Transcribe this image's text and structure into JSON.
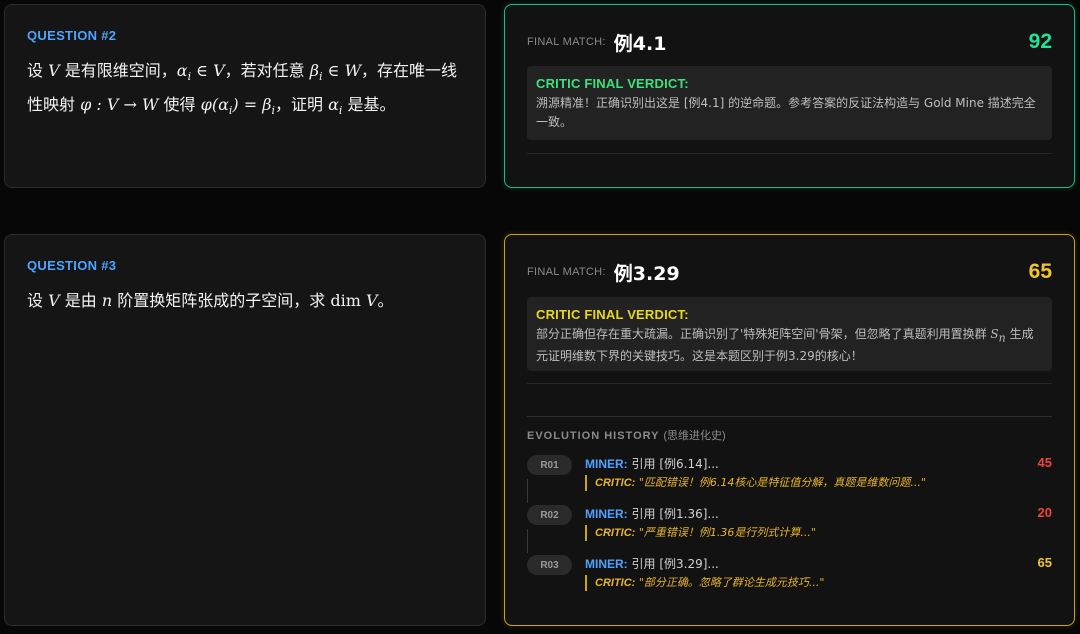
{
  "questions": [
    {
      "label": "QUESTION #2",
      "text_parts": [
        "设 ",
        "V",
        " 是有限维空间，",
        "α",
        "i",
        " ∈ ",
        "V",
        "，若对任意 ",
        "β",
        "i",
        " ∈ ",
        "W",
        "，存在唯一线性映射 ",
        "φ : V → W",
        " 使得 ",
        "φ(α",
        "i",
        ") = β",
        "i",
        "，证明 ",
        "α",
        "i",
        " 是基。"
      ]
    },
    {
      "label": "QUESTION #3",
      "text_parts": [
        "设 ",
        "V",
        " 是由 ",
        "n",
        " 阶置换矩阵张成的子空间，求 ",
        "dim",
        " ",
        "V",
        "。"
      ]
    }
  ],
  "answers": [
    {
      "match_label": "FINAL MATCH:",
      "match_title": "例4.1",
      "score": "92",
      "score_color": "#22e39a",
      "verdict_title": "CRITIC FINAL VERDICT:",
      "verdict_text": "溯源精准！正确识别出这是 [例4.1] 的逆命题。参考答案的反证法构造与 Gold Mine 描述完全一致。"
    },
    {
      "match_label": "FINAL MATCH:",
      "match_title": "例3.29",
      "score": "65",
      "score_color": "#f2c530",
      "verdict_title": "CRITIC FINAL VERDICT:",
      "verdict_text_a": "部分正确但存在重大疏漏。正确识别了'特殊矩阵空间'骨架，但忽略了真题利用置换群 ",
      "verdict_math": "S",
      "verdict_math_sub": "n",
      "verdict_text_b": " 生成元证明维数下界的关键技巧。这是本题区别于例3.29的核心！",
      "evolution": {
        "title": "EVOLUTION HISTORY",
        "title_cn": "(思维进化史)",
        "rounds": [
          {
            "round": "R01",
            "miner_label": "MINER:",
            "miner_text": "引用 [例6.14]...",
            "critic_label": "CRITIC:",
            "critic_text": "\"匹配错误！例6.14核心是特征值分解，真题是维数问题...\"",
            "score": "45"
          },
          {
            "round": "R02",
            "miner_label": "MINER:",
            "miner_text": "引用 [例1.36]...",
            "critic_label": "CRITIC:",
            "critic_text": "\"严重错误！例1.36是行列式计算...\"",
            "score": "20"
          },
          {
            "round": "R03",
            "miner_label": "MINER:",
            "miner_text": "引用 [例3.29]...",
            "critic_label": "CRITIC:",
            "critic_text": "\"部分正确。忽略了群论生成元技巧...\"",
            "score": "65"
          }
        ]
      }
    }
  ]
}
